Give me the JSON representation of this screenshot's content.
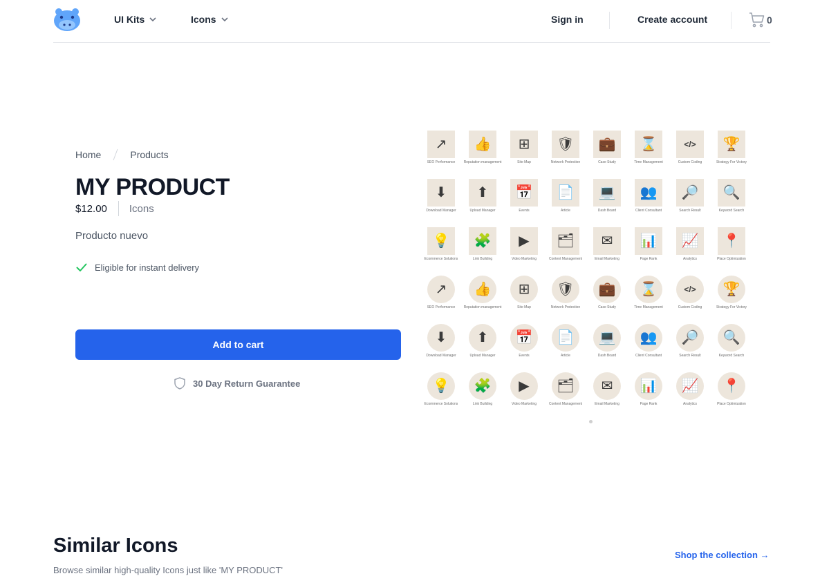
{
  "header": {
    "nav": [
      {
        "label": "UI Kits"
      },
      {
        "label": "Icons"
      }
    ],
    "sign_in": "Sign in",
    "create_account": "Create account",
    "cart_count": "0"
  },
  "breadcrumb": [
    {
      "label": "Home"
    },
    {
      "label": "Products"
    }
  ],
  "product": {
    "title": "MY PRODUCT",
    "price": "$12.00",
    "category": "Icons",
    "description": "Producto nuevo",
    "delivery": "Eligible for instant delivery",
    "add_to_cart": "Add to cart",
    "guarantee": "30 Day Return Guarantee"
  },
  "gallery": {
    "tile_color": "#ede6dc",
    "rows": [
      {
        "shape": "square",
        "icons": [
          {
            "glyph": "↗",
            "label": "SEO Performance"
          },
          {
            "glyph": "👍",
            "label": "Reputation management"
          },
          {
            "glyph": "⊞",
            "label": "Site Map"
          },
          {
            "glyph": "🛡",
            "label": "Network Protection"
          },
          {
            "glyph": "💼",
            "label": "Case Study"
          },
          {
            "glyph": "⌛",
            "label": "Time Management"
          },
          {
            "glyph": "</>",
            "label": "Custom Coding"
          },
          {
            "glyph": "🏆",
            "label": "Strategy For Victory"
          }
        ]
      },
      {
        "shape": "square",
        "icons": [
          {
            "glyph": "⬇",
            "label": "Download Manager"
          },
          {
            "glyph": "⬆",
            "label": "Upload Manager"
          },
          {
            "glyph": "📅",
            "label": "Events"
          },
          {
            "glyph": "📄",
            "label": "Article"
          },
          {
            "glyph": "💻",
            "label": "Dash Board"
          },
          {
            "glyph": "👥",
            "label": "Client Consultant"
          },
          {
            "glyph": "🔎",
            "label": "Search Result"
          },
          {
            "glyph": "🔍",
            "label": "Keyword Search"
          }
        ]
      },
      {
        "shape": "square",
        "icons": [
          {
            "glyph": "💡",
            "label": "Ecommerce Solutions"
          },
          {
            "glyph": "🧩",
            "label": "Link Building"
          },
          {
            "glyph": "▶",
            "label": "Video Marketing"
          },
          {
            "glyph": "🗂",
            "label": "Content Management"
          },
          {
            "glyph": "✉",
            "label": "Email Marketing"
          },
          {
            "glyph": "📊",
            "label": "Page Rank"
          },
          {
            "glyph": "📈",
            "label": "Analytics"
          },
          {
            "glyph": "📍",
            "label": "Place Optimization"
          }
        ]
      },
      {
        "shape": "circle",
        "icons": [
          {
            "glyph": "↗",
            "label": "SEO Performance"
          },
          {
            "glyph": "👍",
            "label": "Reputation management"
          },
          {
            "glyph": "⊞",
            "label": "Site Map"
          },
          {
            "glyph": "🛡",
            "label": "Network Protection"
          },
          {
            "glyph": "💼",
            "label": "Case Study"
          },
          {
            "glyph": "⌛",
            "label": "Time Management"
          },
          {
            "glyph": "</>",
            "label": "Custom Coding"
          },
          {
            "glyph": "🏆",
            "label": "Strategy For Victory"
          }
        ]
      },
      {
        "shape": "circle",
        "icons": [
          {
            "glyph": "⬇",
            "label": "Download Manager"
          },
          {
            "glyph": "⬆",
            "label": "Upload Manager"
          },
          {
            "glyph": "📅",
            "label": "Events"
          },
          {
            "glyph": "📄",
            "label": "Article"
          },
          {
            "glyph": "💻",
            "label": "Dash Board"
          },
          {
            "glyph": "👥",
            "label": "Client Consultant"
          },
          {
            "glyph": "🔎",
            "label": "Search Result"
          },
          {
            "glyph": "🔍",
            "label": "Keyword Search"
          }
        ]
      },
      {
        "shape": "circle",
        "icons": [
          {
            "glyph": "💡",
            "label": "Ecommerce Solutions"
          },
          {
            "glyph": "🧩",
            "label": "Link Building"
          },
          {
            "glyph": "▶",
            "label": "Video Marketing"
          },
          {
            "glyph": "🗂",
            "label": "Content Management"
          },
          {
            "glyph": "✉",
            "label": "Email Marketing"
          },
          {
            "glyph": "📊",
            "label": "Page Rank"
          },
          {
            "glyph": "📈",
            "label": "Analytics"
          },
          {
            "glyph": "📍",
            "label": "Place Optimization"
          }
        ]
      }
    ]
  },
  "similar": {
    "title": "Similar Icons",
    "subtitle": "Browse similar high-quality Icons just like 'MY PRODUCT'",
    "shop_link": "Shop the collection →"
  },
  "colors": {
    "accent": "#2563eb",
    "check": "#22c55e",
    "logo": "#60a5fa"
  }
}
